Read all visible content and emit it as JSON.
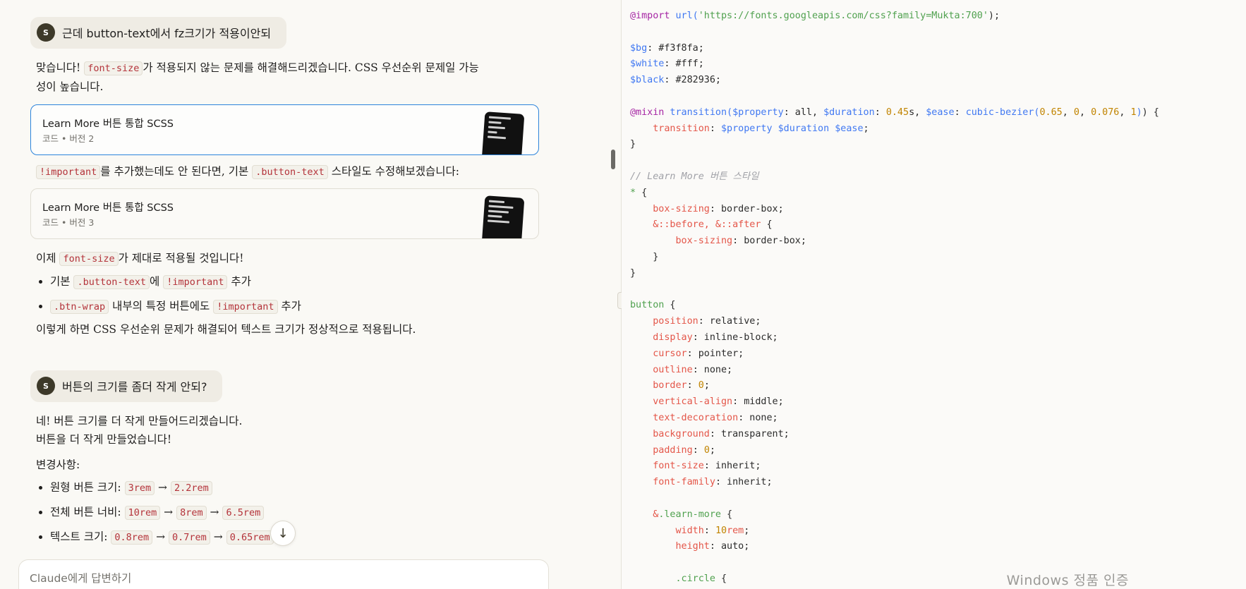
{
  "chat": {
    "msg1": {
      "avatar": "S",
      "text": "근데 button-text에서 fz크기가 적용이안되"
    },
    "reply1": {
      "line_a": "맞습니다! ",
      "code_a": "font-size",
      "line_b": "가 적용되지 않는 문제를 해결해드리겠습니다. CSS 우선순위 문제일 가능",
      "line_c": "성이 높습니다."
    },
    "artifact1": {
      "title": "Learn More 버튼 통합 SCSS",
      "kind": "코드",
      "version": "버전 2"
    },
    "reply2": {
      "code_a": "!important",
      "text_b": "를 추가했는데도 안 된다면, 기본 ",
      "code_b": ".button-text",
      "text_c": " 스타일도 수정해보겠습니다:"
    },
    "artifact2": {
      "title": "Learn More 버튼 통합 SCSS",
      "kind": "코드",
      "version": "버전 3"
    },
    "reply3": {
      "text_a": "이제 ",
      "code_a": "font-size",
      "text_b": "가 제대로 적용될 것입니다!",
      "bullet1_a": "기본 ",
      "bullet1_code": ".button-text",
      "bullet1_b": "에 ",
      "bullet1_code2": "!important",
      "bullet1_c": " 추가",
      "bullet2_code": ".btn-wrap",
      "bullet2_a": " 내부의 특정 버튼에도 ",
      "bullet2_code2": "!important",
      "bullet2_b": " 추가",
      "closing": "이렇게 하면 CSS 우선순위 문제가 해결되어 텍스트 크기가 정상적으로 적용됩니다."
    },
    "msg2": {
      "avatar": "S",
      "text": "버튼의 크기를 좀더 작게 안되?"
    },
    "reply4": {
      "line1": "네! 버튼 크기를 더 작게 만들어드리겠습니다.",
      "line2": "버튼을 더 작게 만들었습니다!",
      "changes": "변경사항:",
      "b1_label": "원형 버튼 크기: ",
      "b1_v1": "3rem",
      "b1_v2": "2.2rem",
      "b2_label": "전체 버튼 너비: ",
      "b2_v1": "10rem",
      "b2_v2": "8rem",
      "b2_v3": "6.5rem",
      "b3_label": "텍스트 크기: ",
      "b3_v1": "0.8rem",
      "b3_v2": "0.7rem",
      "b3_v3": "0.65rem",
      "arrow": "→"
    },
    "composer_placeholder": "Claude에게 답변하기",
    "scroll_down_icon": "↓"
  },
  "code_view": {
    "lines": [
      [
        [
          "c-at",
          "@import"
        ],
        [
          "",
          ""
        ],
        [
          "c-fn",
          " url("
        ],
        [
          "c-str",
          "'https://fonts.googleapis.com/css?family=Mukta:700'"
        ],
        [
          "",
          ");"
        ]
      ],
      [],
      [
        [
          "c-var",
          "$bg"
        ],
        [
          "",
          ": #f3f8fa;"
        ]
      ],
      [
        [
          "c-var",
          "$white"
        ],
        [
          "",
          ": #fff;"
        ]
      ],
      [
        [
          "c-var",
          "$black"
        ],
        [
          "",
          ": #282936;"
        ]
      ],
      [],
      [
        [
          "c-at",
          "@mixin"
        ],
        [
          "c-fn",
          " transition("
        ],
        [
          "c-var",
          "$property"
        ],
        [
          "",
          ": all, "
        ],
        [
          "c-var",
          "$duration"
        ],
        [
          "",
          ": "
        ],
        [
          "c-num",
          "0.45"
        ],
        [
          "",
          "s, "
        ],
        [
          "c-var",
          "$ease"
        ],
        [
          "",
          ": "
        ],
        [
          "c-fn",
          "cubic-bezier("
        ],
        [
          "c-num",
          "0.65"
        ],
        [
          "",
          ", "
        ],
        [
          "c-num",
          "0"
        ],
        [
          "",
          ", "
        ],
        [
          "c-num",
          "0.076"
        ],
        [
          "",
          ", "
        ],
        [
          "c-num",
          "1"
        ],
        [
          "c-fn",
          ")"
        ],
        [
          "",
          ") {"
        ]
      ],
      [
        [
          "",
          "    "
        ],
        [
          "c-prop",
          "transition"
        ],
        [
          "",
          ": "
        ],
        [
          "c-var",
          "$property $duration $ease"
        ],
        [
          "",
          ";"
        ]
      ],
      [
        [
          "",
          "}"
        ]
      ],
      [],
      [
        [
          "c-com",
          "// Learn More 버튼 스타일"
        ]
      ],
      [
        [
          "c-sel",
          "*"
        ],
        [
          "",
          " {"
        ]
      ],
      [
        [
          "",
          "    "
        ],
        [
          "c-prop",
          "box-sizing"
        ],
        [
          "",
          ": border-box;"
        ]
      ],
      [
        [
          "",
          "    "
        ],
        [
          "c-amp",
          "&::before, &::after"
        ],
        [
          "",
          " {"
        ]
      ],
      [
        [
          "",
          "        "
        ],
        [
          "c-prop",
          "box-sizing"
        ],
        [
          "",
          ": border-box;"
        ]
      ],
      [
        [
          "",
          "    }"
        ]
      ],
      [
        [
          "",
          "}"
        ]
      ],
      [],
      [
        [
          "c-sel",
          "button"
        ],
        [
          "",
          " {"
        ]
      ],
      [
        [
          "",
          "    "
        ],
        [
          "c-prop",
          "position"
        ],
        [
          "",
          ": relative;"
        ]
      ],
      [
        [
          "",
          "    "
        ],
        [
          "c-prop",
          "display"
        ],
        [
          "",
          ": inline-block;"
        ]
      ],
      [
        [
          "",
          "    "
        ],
        [
          "c-prop",
          "cursor"
        ],
        [
          "",
          ": pointer;"
        ]
      ],
      [
        [
          "",
          "    "
        ],
        [
          "c-prop",
          "outline"
        ],
        [
          "",
          ": none;"
        ]
      ],
      [
        [
          "",
          "    "
        ],
        [
          "c-prop",
          "border"
        ],
        [
          "",
          ": "
        ],
        [
          "c-num",
          "0"
        ],
        [
          "",
          ";"
        ]
      ],
      [
        [
          "",
          "    "
        ],
        [
          "c-prop",
          "vertical-align"
        ],
        [
          "",
          ": middle;"
        ]
      ],
      [
        [
          "",
          "    "
        ],
        [
          "c-prop",
          "text-decoration"
        ],
        [
          "",
          ": none;"
        ]
      ],
      [
        [
          "",
          "    "
        ],
        [
          "c-prop",
          "background"
        ],
        [
          "",
          ": transparent;"
        ]
      ],
      [
        [
          "",
          "    "
        ],
        [
          "c-prop",
          "padding"
        ],
        [
          "",
          ": "
        ],
        [
          "c-num",
          "0"
        ],
        [
          "",
          ";"
        ]
      ],
      [
        [
          "",
          "    "
        ],
        [
          "c-prop",
          "font-size"
        ],
        [
          "",
          ": inherit;"
        ]
      ],
      [
        [
          "",
          "    "
        ],
        [
          "c-prop",
          "font-family"
        ],
        [
          "",
          ": inherit;"
        ]
      ],
      [],
      [
        [
          "",
          "    "
        ],
        [
          "c-amp",
          "&"
        ],
        [
          "c-sel",
          ".learn-more"
        ],
        [
          "",
          " {"
        ]
      ],
      [
        [
          "",
          "        "
        ],
        [
          "c-prop",
          "width"
        ],
        [
          "",
          ": "
        ],
        [
          "c-num",
          "10"
        ],
        [
          "c-prop",
          "rem"
        ],
        [
          "",
          ";"
        ]
      ],
      [
        [
          "",
          "        "
        ],
        [
          "c-prop",
          "height"
        ],
        [
          "",
          ": auto;"
        ]
      ],
      [],
      [
        [
          "",
          "        "
        ],
        [
          "c-sel",
          ".circle"
        ],
        [
          "",
          " {"
        ]
      ]
    ]
  },
  "watermark": "Windows 정품 인증"
}
